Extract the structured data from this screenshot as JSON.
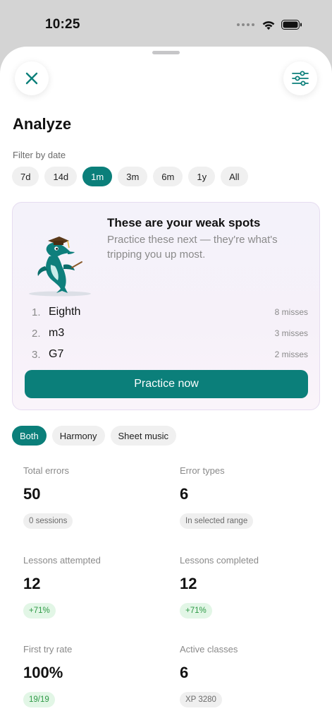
{
  "status_bar": {
    "time": "10:25"
  },
  "header": {
    "title": "Analyze"
  },
  "date_filter": {
    "label": "Filter by date",
    "options": [
      "7d",
      "14d",
      "1m",
      "3m",
      "6m",
      "1y",
      "All"
    ],
    "selected": "1m"
  },
  "weak_spots": {
    "title": "These are your weak spots",
    "subtitle": "Practice these next — they're what's tripping you up most.",
    "items": [
      {
        "rank": "1.",
        "name": "Eighth",
        "misses": "8 misses"
      },
      {
        "rank": "2.",
        "name": "m3",
        "misses": "3 misses"
      },
      {
        "rank": "3.",
        "name": "G7",
        "misses": "2 misses"
      }
    ],
    "button_label": "Practice now"
  },
  "type_filter": {
    "options": [
      "Both",
      "Harmony",
      "Sheet music"
    ],
    "selected": "Both"
  },
  "stats": [
    {
      "label": "Total errors",
      "value": "50",
      "badge": "0 sessions",
      "badge_tone": "gray"
    },
    {
      "label": "Error types",
      "value": "6",
      "badge": "In selected range",
      "badge_tone": "gray"
    },
    {
      "label": "Lessons attempted",
      "value": "12",
      "badge": "+71%",
      "badge_tone": "green"
    },
    {
      "label": "Lessons completed",
      "value": "12",
      "badge": "+71%",
      "badge_tone": "green"
    },
    {
      "label": "First try rate",
      "value": "100%",
      "badge": "19/19",
      "badge_tone": "green"
    },
    {
      "label": "Active classes",
      "value": "6",
      "badge": "XP 3280",
      "badge_tone": "gray"
    }
  ],
  "colors": {
    "accent": "#0b7f7a",
    "positive": "#2f9a47",
    "muted": "#8a8a8a"
  }
}
